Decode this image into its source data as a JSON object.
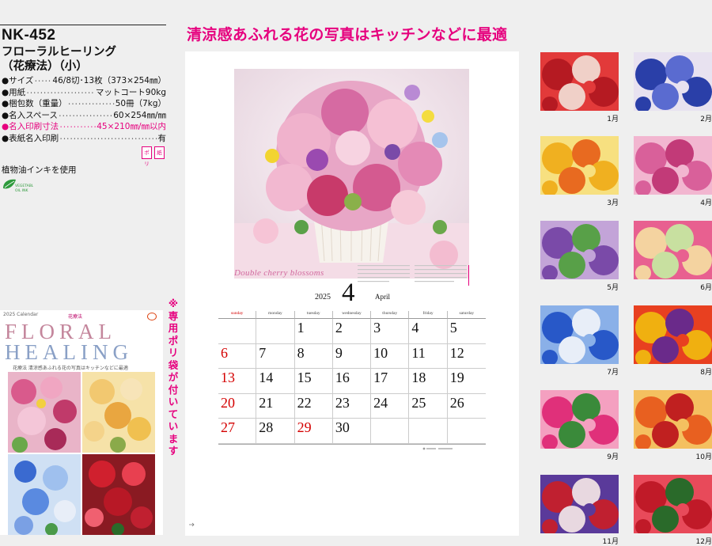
{
  "product": {
    "code": "NK-452",
    "name_line1": "フローラルヒーリング",
    "name_line2": "（花療法）（小）",
    "specs": [
      {
        "label": "●サイズ",
        "value": "46/8切･13枚（373×254㎜）",
        "highlight": false
      },
      {
        "label": "●用紙",
        "value": "マットコート90kg",
        "highlight": false
      },
      {
        "label": "●梱包数（重量）",
        "value": "50冊（7kg）",
        "highlight": false
      },
      {
        "label": "●名入スペース",
        "value": "60×254㎜/㎜",
        "highlight": false
      },
      {
        "label": "●名入印刷寸法",
        "value": "45×210㎜/㎜以内",
        "highlight": true
      },
      {
        "label": "●表紙名入印刷",
        "value": "有",
        "highlight": false
      }
    ],
    "icons": [
      "ポリ",
      "紙"
    ],
    "ink_note": "植物油インキを使用",
    "veg_logo_text": "VEGETABLE OIL INK"
  },
  "headline": "清涼感あふれる花の写真はキッチンなどに最適",
  "side_note": "※専用ポリ袋が付いています",
  "cover": {
    "header": "2025 Calendar",
    "title_line1": "FLORAL",
    "title_line2": "HEALING",
    "subtitle": "花療法",
    "meta": "花療法  清涼感あふれる花の写真はキッチンなどに最適"
  },
  "poster": {
    "photo_title": "Double cherry blossoms",
    "year": "2025",
    "month_number": "4",
    "month_name": "April",
    "weekdays": [
      "sunday",
      "monday",
      "tuesday",
      "wednesday",
      "thursday",
      "friday",
      "saturday"
    ],
    "rows": [
      [
        "",
        "",
        "1",
        "2",
        "3",
        "4",
        "5"
      ],
      [
        "6",
        "7",
        "8",
        "9",
        "10",
        "11",
        "12"
      ],
      [
        "13",
        "14",
        "15",
        "16",
        "17",
        "18",
        "19"
      ],
      [
        "20",
        "21",
        "22",
        "23",
        "24",
        "25",
        "26"
      ],
      [
        "27",
        "28",
        "29",
        "30",
        "",
        "",
        ""
      ]
    ],
    "red_days": [
      "6",
      "13",
      "20",
      "27",
      "29"
    ]
  },
  "thumbnails": [
    {
      "label": "1月",
      "colors": [
        "#b51a22",
        "#e23a3a",
        "#f0d0c8"
      ]
    },
    {
      "label": "2月",
      "colors": [
        "#2a3fa8",
        "#e8e2f0",
        "#5a6bd0"
      ]
    },
    {
      "label": "3月",
      "colors": [
        "#f0b020",
        "#f7e080",
        "#e86a20"
      ]
    },
    {
      "label": "4月",
      "colors": [
        "#d9609a",
        "#f2b6d0",
        "#c23a78"
      ]
    },
    {
      "label": "5月",
      "colors": [
        "#7a4aa8",
        "#c3a4d8",
        "#58a048"
      ]
    },
    {
      "label": "6月",
      "colors": [
        "#f4d3a0",
        "#e86090",
        "#c8e0a0"
      ]
    },
    {
      "label": "7月",
      "colors": [
        "#2858c8",
        "#8ab0e8",
        "#e8eef8"
      ]
    },
    {
      "label": "8月",
      "colors": [
        "#f0b010",
        "#e84020",
        "#6a2a8a"
      ]
    },
    {
      "label": "9月",
      "colors": [
        "#e0307a",
        "#f4a0c0",
        "#3a8a3a"
      ]
    },
    {
      "label": "10月",
      "colors": [
        "#e86020",
        "#f4c060",
        "#c02020"
      ]
    },
    {
      "label": "11月",
      "colors": [
        "#c02030",
        "#5a3a9a",
        "#e8d8e0"
      ]
    },
    {
      "label": "12月",
      "colors": [
        "#c01a28",
        "#e84a5a",
        "#2a6a2a"
      ]
    }
  ],
  "accent_color": "#e6007e"
}
